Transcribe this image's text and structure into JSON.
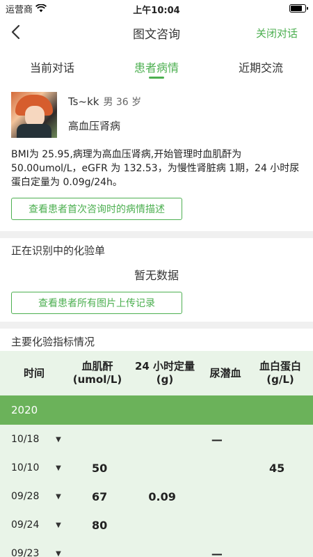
{
  "status": {
    "carrier": "运营商",
    "time": "上午10:04",
    "battery_level": 0.85
  },
  "nav": {
    "title": "图文咨询",
    "close_label": "关闭对话"
  },
  "tabs": [
    {
      "label": "当前对话",
      "active": false
    },
    {
      "label": "患者病情",
      "active": true
    },
    {
      "label": "近期交流",
      "active": false
    }
  ],
  "patient": {
    "name": "Ts~kk",
    "meta": "男 36 岁",
    "diagnosis": "高血压肾病",
    "description": "BMI为 25.95,病理为高血压肾病,开始管理时血肌酐为 50.00umol/L，eGFR 为 132.53，为慢性肾脏病 1期，24 小时尿蛋白定量为 0.09g/24h。",
    "first_consult_button": "查看患者首次咨询时的病情描述"
  },
  "lab_recognition": {
    "title": "正在识别中的化验单",
    "empty": "暂无数据",
    "upload_button": "查看患者所有图片上传记录"
  },
  "indicators": {
    "title": "主要化验指标情况",
    "headers": [
      "时间",
      "血肌酐\n(umol/L)",
      "24 小时定量\n(g)",
      "尿潜血",
      "血白蛋白\n(g/L)"
    ],
    "year": "2020",
    "rows": [
      {
        "date": "10/18",
        "creatinine": "",
        "urine_protein": "",
        "occult_blood": "—",
        "albumin": ""
      },
      {
        "date": "10/10",
        "creatinine": "50",
        "urine_protein": "",
        "occult_blood": "",
        "albumin": "45"
      },
      {
        "date": "09/28",
        "creatinine": "67",
        "urine_protein": "0.09",
        "occult_blood": "",
        "albumin": ""
      },
      {
        "date": "09/24",
        "creatinine": "80",
        "urine_protein": "",
        "occult_blood": "",
        "albumin": ""
      },
      {
        "date": "09/23",
        "creatinine": "",
        "urine_protein": "",
        "occult_blood": "—",
        "albumin": ""
      }
    ]
  },
  "colors": {
    "accent": "#4caf50",
    "year_bar": "#6bb25a",
    "table_bg": "#e9f4e8",
    "divider": "#f0f0f0"
  }
}
